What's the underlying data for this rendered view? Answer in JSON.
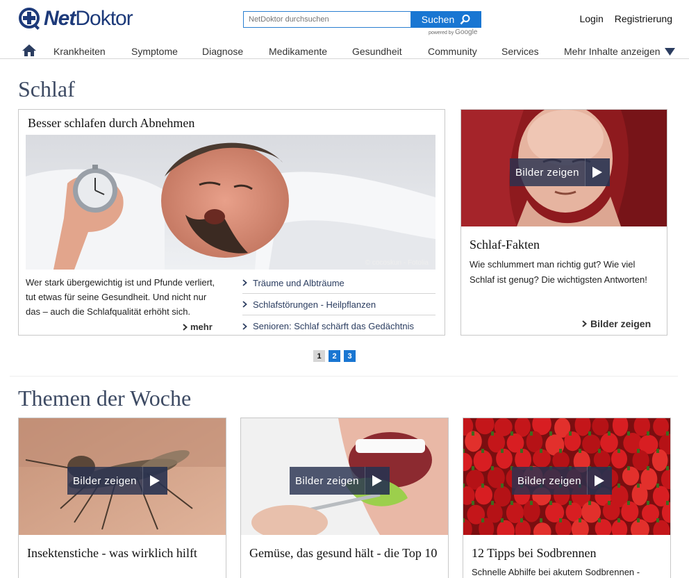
{
  "brand": {
    "net": "Net",
    "doktor": "Doktor"
  },
  "search": {
    "placeholder": "NetDoktor durchsuchen",
    "button": "Suchen",
    "powered": "powered by",
    "google": "Google"
  },
  "top_links": {
    "login": "Login",
    "register": "Registrierung"
  },
  "nav": {
    "items": [
      "Krankheiten",
      "Symptome",
      "Diagnose",
      "Medikamente",
      "Gesundheit",
      "Community",
      "Services"
    ],
    "more": "Mehr Inhalte anzeigen"
  },
  "section": {
    "title": "Schlaf"
  },
  "feature": {
    "title": "Besser schlafen durch Abnehmen",
    "credit": "© cocoskun - Fotolia",
    "text": "Wer stark übergewichtig ist und Pfunde verliert, tut etwas für seine Gesundheit. Und nicht nur das – auch die Schlafqualität erhöht sich.",
    "more": "mehr",
    "links": [
      "Träume und Albträume",
      "Schlafstörungen - Heilpflanzen",
      "Senioren: Schlaf schärft das Gedächtnis"
    ]
  },
  "side": {
    "button": "Bilder zeigen",
    "title": "Schlaf-Fakten",
    "text": "Wie schlummert man richtig gut? Wie viel Schlaf ist genug? Die wichtigsten Antworten!",
    "more": "Bilder zeigen"
  },
  "pager": {
    "pages": [
      "1",
      "2",
      "3"
    ],
    "active": "1"
  },
  "themes": {
    "title": "Themen der Woche",
    "button": "Bilder zeigen",
    "cards": [
      {
        "title": "Insektenstiche - was wirklich hilft",
        "text": ""
      },
      {
        "title": "Gemüse, das gesund hält - die Top 10",
        "text": ""
      },
      {
        "title": "12 Tipps bei Sodbrennen",
        "text": "Schnelle Abhilfe bei akutem Sodbrennen -"
      }
    ]
  },
  "colors": {
    "brand_blue": "#1d3a7a",
    "accent_blue": "#1976d2",
    "heading": "#3d4a63"
  }
}
